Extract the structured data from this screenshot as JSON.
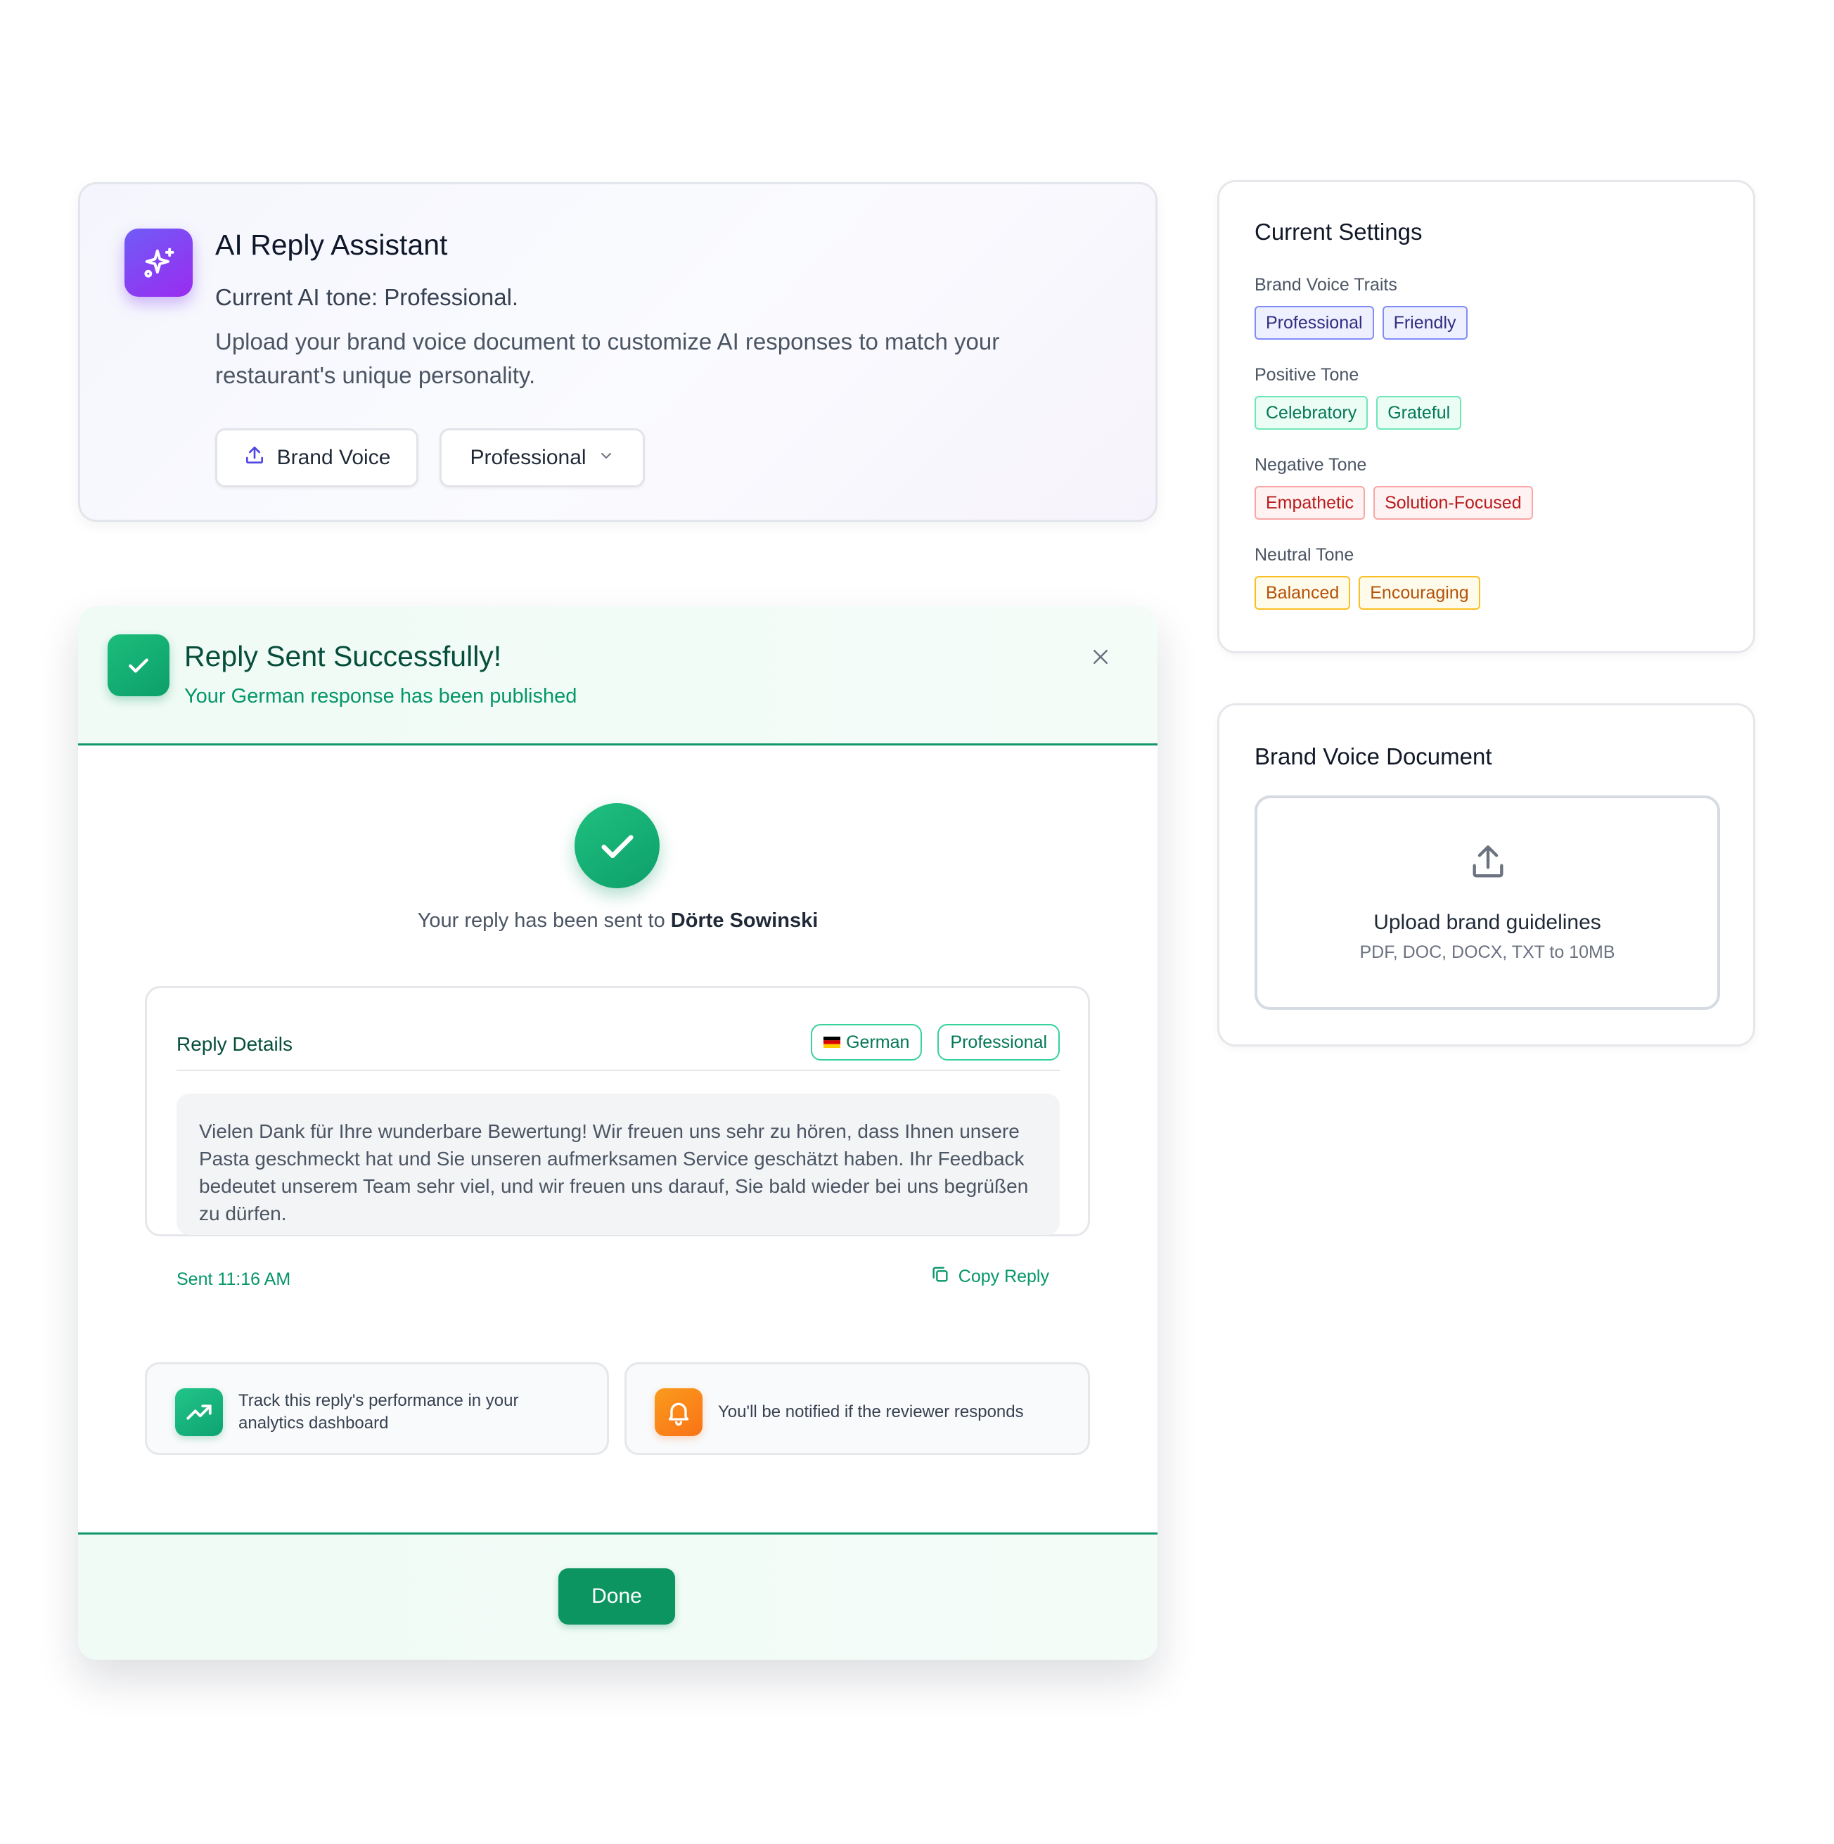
{
  "assistant": {
    "title": "AI Reply Assistant",
    "current_tone": "Current AI tone: Professional.",
    "description": "Upload your brand voice document to customize AI responses to match your restaurant's unique personality.",
    "brand_voice_button": "Brand Voice",
    "tone_select": "Professional",
    "icon": "sparkles-icon"
  },
  "settings": {
    "title": "Current Settings",
    "groups": [
      {
        "label": "Brand Voice Traits",
        "chips": [
          "Professional",
          "Friendly"
        ],
        "color": "#4f46e5"
      },
      {
        "label": "Positive Tone",
        "chips": [
          "Celebratory",
          "Grateful"
        ],
        "color": "#059669"
      },
      {
        "label": "Negative Tone",
        "chips": [
          "Empathetic",
          "Solution-Focused"
        ],
        "color": "#dc2626"
      },
      {
        "label": "Neutral Tone",
        "chips": [
          "Balanced",
          "Encouraging"
        ],
        "color": "#d97706"
      }
    ]
  },
  "document": {
    "title": "Brand Voice Document",
    "upload_title": "Upload brand guidelines",
    "upload_hint": "PDF, DOC, DOCX, TXT to 10MB"
  },
  "modal": {
    "title": "Reply Sent Successfully!",
    "subtitle": "Your German response has been published",
    "sent_prefix": "Your reply has been sent to ",
    "recipient": "Dörte Sowinski",
    "details": {
      "title": "Reply Details",
      "language_badge": "German",
      "tone_badge": "Professional",
      "reply_text": "Vielen Dank für Ihre wunderbare Bewertung! Wir freuen uns sehr zu hören, dass Ihnen unsere Pasta geschmeckt hat und Sie unseren aufmerksamen Service geschätzt haben. Ihr Feedback bedeutet unserem Team sehr viel, und wir freuen uns darauf, Sie bald wieder bei uns begrüßen zu dürfen.",
      "sent_time": "Sent 11:16 AM",
      "copy_label": "Copy Reply"
    },
    "info": {
      "analytics": "Track this reply's performance in your analytics dashboard",
      "notify": "You'll be notified if the reviewer responds"
    },
    "done_label": "Done"
  },
  "colors": {
    "accent_purple": "#7c3aed",
    "success_green": "#0c9461",
    "notify_orange": "#f97316"
  }
}
